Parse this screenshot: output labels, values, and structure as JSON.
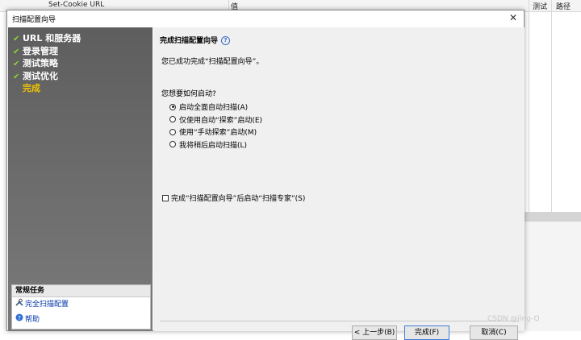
{
  "background": {
    "columns": [
      "Set-Cookie URL",
      "值",
      "测试",
      "路径"
    ]
  },
  "dialog": {
    "title": "扫描配置向导",
    "close_glyph": "✕",
    "steps": [
      {
        "label": "URL 和服务器",
        "done": true
      },
      {
        "label": "登录管理",
        "done": true
      },
      {
        "label": "测试策略",
        "done": true
      },
      {
        "label": "测试优化",
        "done": true
      },
      {
        "label": "完成",
        "done": false
      }
    ],
    "tasks": {
      "header": "常规任务",
      "items": [
        {
          "label": "完全扫描配置",
          "icon": "tools-icon"
        },
        {
          "label": "帮助",
          "icon": "help-icon"
        }
      ]
    },
    "content": {
      "title": "完成扫描配置向导",
      "message": "您已成功完成“扫描配置向导”。",
      "question": "您想要如何启动?",
      "options": [
        {
          "label": "启动全面自动扫描(A)",
          "selected": true
        },
        {
          "label": "仅使用自动“探索”启动(E)",
          "selected": false
        },
        {
          "label": "使用“手动探索”启动(M)",
          "selected": false
        },
        {
          "label": "我将稍后启动扫描(L)",
          "selected": false
        }
      ],
      "checkbox_label": "完成“扫描配置向导”后启动“扫描专家”(S)",
      "checkbox_checked": false
    },
    "buttons": {
      "back": "< 上一步(B)",
      "finish": "完成(F)",
      "cancel": "取消(C)"
    }
  },
  "watermark": "CSDN @jing-Q"
}
